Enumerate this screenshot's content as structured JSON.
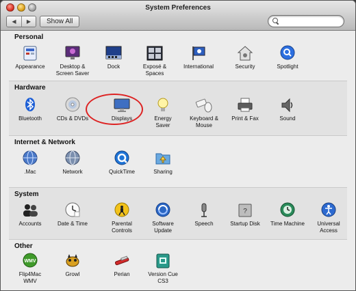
{
  "window": {
    "title": "System Preferences"
  },
  "toolbar": {
    "back": "◀",
    "forward": "▶",
    "show_all": "Show All",
    "search_placeholder": ""
  },
  "sections": [
    {
      "title": "Personal",
      "items": [
        {
          "label": "Appearance"
        },
        {
          "label": "Desktop &\nScreen Saver"
        },
        {
          "label": "Dock"
        },
        {
          "label": "Exposé &\nSpaces"
        },
        {
          "label": "International"
        },
        {
          "label": "Security"
        },
        {
          "label": "Spotlight"
        }
      ]
    },
    {
      "title": "Hardware",
      "items": [
        {
          "label": "Bluetooth"
        },
        {
          "label": "CDs & DVDs"
        },
        {
          "label": "Displays"
        },
        {
          "label": "Energy\nSaver"
        },
        {
          "label": "Keyboard &\nMouse"
        },
        {
          "label": "Print & Fax"
        },
        {
          "label": "Sound"
        }
      ]
    },
    {
      "title": "Internet & Network",
      "items": [
        {
          "label": ".Mac"
        },
        {
          "label": "Network"
        },
        {
          "label": "QuickTime"
        },
        {
          "label": "Sharing"
        }
      ]
    },
    {
      "title": "System",
      "items": [
        {
          "label": "Accounts"
        },
        {
          "label": "Date & Time"
        },
        {
          "label": "Parental\nControls"
        },
        {
          "label": "Software\nUpdate"
        },
        {
          "label": "Speech"
        },
        {
          "label": "Startup Disk"
        },
        {
          "label": "Time Machine"
        },
        {
          "label": "Universal\nAccess"
        }
      ]
    },
    {
      "title": "Other",
      "items": [
        {
          "label": "Flip4Mac\nWMV"
        },
        {
          "label": "Growl"
        },
        {
          "label": "Perian"
        },
        {
          "label": "Version Cue\nCS3"
        }
      ]
    }
  ]
}
